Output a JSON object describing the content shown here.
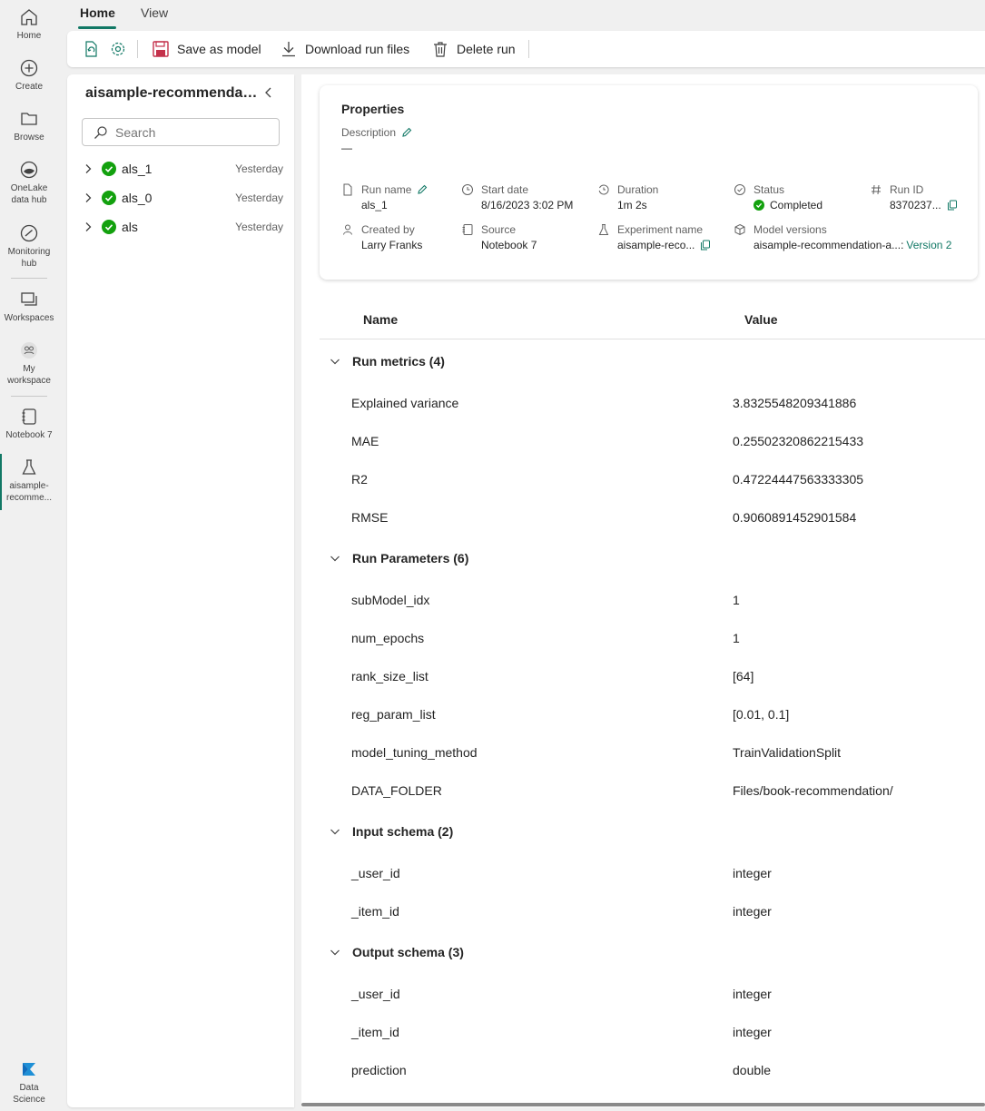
{
  "rail": {
    "items": [
      {
        "label": "Home",
        "icon": "home-icon"
      },
      {
        "label": "Create",
        "icon": "plus-circle-icon"
      },
      {
        "label": "Browse",
        "icon": "folder-icon"
      },
      {
        "label_1": "OneLake",
        "label_2": "data hub",
        "icon": "onelake-icon"
      },
      {
        "label_1": "Monitoring",
        "label_2": "hub",
        "icon": "monitor-icon"
      },
      {
        "label": "Workspaces",
        "icon": "workspaces-icon"
      },
      {
        "label_1": "My",
        "label_2": "workspace",
        "icon": "people-icon"
      },
      {
        "label": "Notebook 7",
        "icon": "notebook-icon"
      },
      {
        "label_1": "aisample-",
        "label_2": "recomme...",
        "icon": "flask-icon"
      },
      {
        "label_1": "Data",
        "label_2": "Science",
        "icon": "data-science-icon"
      }
    ]
  },
  "tabs": {
    "home": "Home",
    "view": "View"
  },
  "toolbar": {
    "save_model": "Save as model",
    "download": "Download run files",
    "delete": "Delete run"
  },
  "panel": {
    "title": "aisample-recommendat...",
    "search_placeholder": "Search",
    "runs": [
      {
        "name": "als_1",
        "when": "Yesterday"
      },
      {
        "name": "als_0",
        "when": "Yesterday"
      },
      {
        "name": "als",
        "when": "Yesterday"
      }
    ]
  },
  "properties": {
    "title": "Properties",
    "description_label": "Description",
    "description_value": "—",
    "run_name_label": "Run name",
    "run_name": "als_1",
    "start_date_label": "Start date",
    "start_date": "8/16/2023 3:02 PM",
    "duration_label": "Duration",
    "duration": "1m 2s",
    "status_label": "Status",
    "status": "Completed",
    "run_id_label": "Run ID",
    "run_id": "8370237...",
    "created_by_label": "Created by",
    "created_by": "Larry Franks",
    "source_label": "Source",
    "source": "Notebook 7",
    "experiment_label": "Experiment name",
    "experiment": "aisample-reco...",
    "model_versions_label": "Model versions",
    "model_versions_prefix": "aisample-recommendation-a...:",
    "model_versions_link": "Version 2"
  },
  "table": {
    "col_name": "Name",
    "col_value": "Value",
    "groups": [
      {
        "title": "Run metrics (4)",
        "rows": [
          {
            "name": "Explained variance",
            "value": "3.8325548209341886"
          },
          {
            "name": "MAE",
            "value": "0.25502320862215433"
          },
          {
            "name": "R2",
            "value": "0.47224447563333305"
          },
          {
            "name": "RMSE",
            "value": "0.9060891452901584"
          }
        ]
      },
      {
        "title": "Run Parameters (6)",
        "rows": [
          {
            "name": "subModel_idx",
            "value": "1"
          },
          {
            "name": "num_epochs",
            "value": "1"
          },
          {
            "name": "rank_size_list",
            "value": "[64]"
          },
          {
            "name": "reg_param_list",
            "value": "[0.01, 0.1]"
          },
          {
            "name": "model_tuning_method",
            "value": "TrainValidationSplit"
          },
          {
            "name": "DATA_FOLDER",
            "value": "Files/book-recommendation/"
          }
        ]
      },
      {
        "title": "Input schema (2)",
        "rows": [
          {
            "name": "_user_id",
            "value": "integer"
          },
          {
            "name": "_item_id",
            "value": "integer"
          }
        ]
      },
      {
        "title": "Output schema (3)",
        "rows": [
          {
            "name": "_user_id",
            "value": "integer"
          },
          {
            "name": "_item_id",
            "value": "integer"
          },
          {
            "name": "prediction",
            "value": "double"
          }
        ]
      }
    ]
  },
  "colors": {
    "accent": "#117865",
    "success": "#13a10e"
  }
}
